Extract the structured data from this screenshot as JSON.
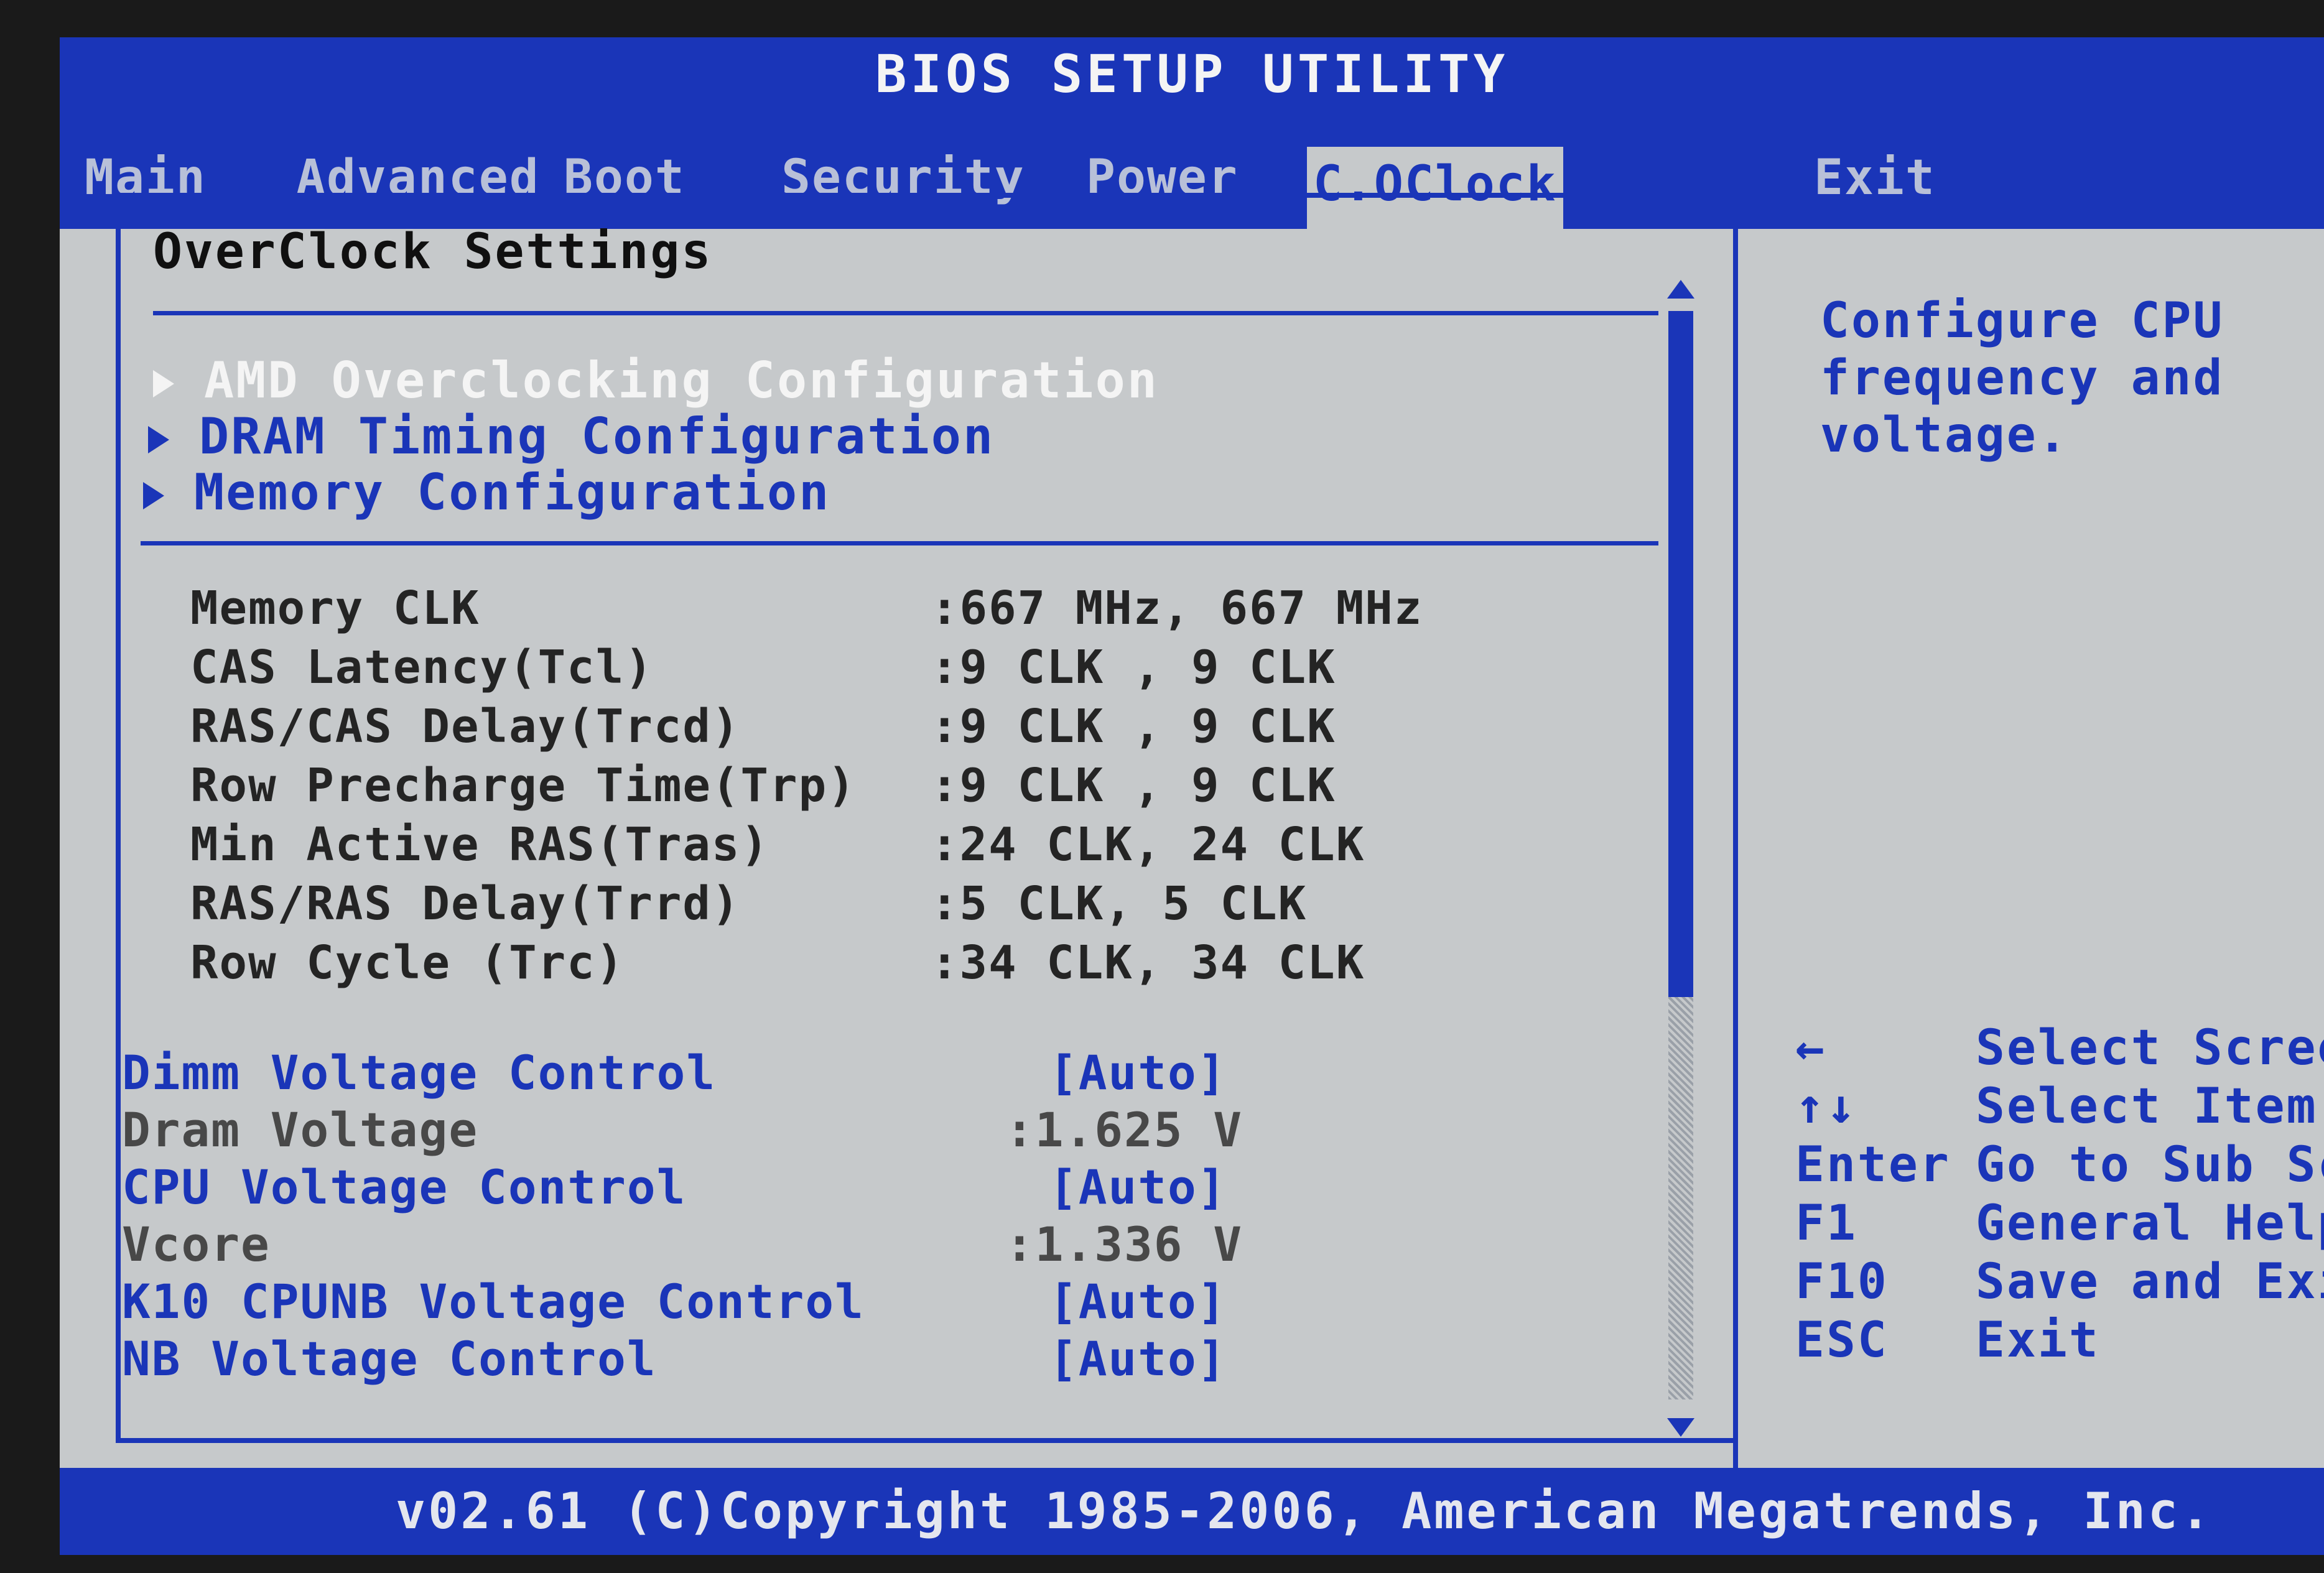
{
  "title": "BIOS SETUP UTILITY",
  "menu": {
    "tabs": [
      "Main",
      "Advanced",
      "Boot",
      "Security",
      "Power",
      "C.OClock",
      "Exit"
    ],
    "active": "C.OClock"
  },
  "section": {
    "title": "OverClock Settings"
  },
  "submenus": [
    "AMD Overclocking Configuration",
    "DRAM Timing Configuration",
    "Memory Configuration"
  ],
  "info": [
    {
      "label": "Memory CLK",
      "value": ":667 MHz, 667 MHz"
    },
    {
      "label": "CAS Latency(Tcl)",
      "value": ":9 CLK , 9 CLK"
    },
    {
      "label": "RAS/CAS Delay(Trcd)",
      "value": ":9 CLK , 9 CLK"
    },
    {
      "label": "Row Precharge Time(Trp)",
      "value": ":9 CLK , 9 CLK"
    },
    {
      "label": "Min Active RAS(Tras)",
      "value": ":24 CLK, 24 CLK"
    },
    {
      "label": "RAS/RAS Delay(Trrd)",
      "value": ":5 CLK, 5 CLK"
    },
    {
      "label": "Row Cycle (Trc)",
      "value": ":34 CLK, 34 CLK"
    }
  ],
  "options": [
    {
      "label": "Dimm Voltage Control",
      "value": "[Auto]"
    },
    {
      "label": "Dram Voltage",
      "value": ":1.625 V"
    },
    {
      "label": "CPU Voltage Control",
      "value": "[Auto]"
    },
    {
      "label": "Vcore",
      "value": ":1.336 V"
    },
    {
      "label": "K10 CPUNB Voltage Control",
      "value": "[Auto]"
    },
    {
      "label": "NB Voltage Control",
      "value": "[Auto]"
    }
  ],
  "help": {
    "text": "Configure CPU frequency and voltage."
  },
  "keys": [
    {
      "key": "←",
      "desc": "Select Screen"
    },
    {
      "key": "↑↓",
      "desc": "Select Item"
    },
    {
      "key": "Enter",
      "desc": "Go to Sub Scre"
    },
    {
      "key": "F1",
      "desc": "General Help"
    },
    {
      "key": "F10",
      "desc": "Save and Exit"
    },
    {
      "key": "ESC",
      "desc": "Exit"
    }
  ],
  "footer": "v02.61 (C)Copyright 1985-2006, American Megatrends, Inc.",
  "colors": {
    "accent": "#1a35b8",
    "background": "#c6c9cb",
    "selected_text": "#f4f4f4"
  }
}
